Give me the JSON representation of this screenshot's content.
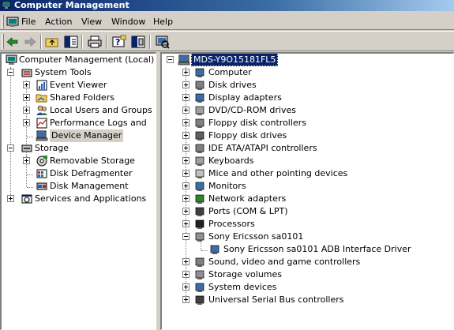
{
  "window": {
    "title": "Computer Management"
  },
  "menu": {
    "file": "File",
    "action": "Action",
    "view": "View",
    "window": "Window",
    "help": "Help"
  },
  "left_tree": {
    "root": "Computer Management (Local)",
    "system_tools": "System Tools",
    "event_viewer": "Event Viewer",
    "shared_folders": "Shared Folders",
    "local_users": "Local Users and Groups",
    "perf_logs": "Performance Logs and Alerts",
    "device_manager": "Device Manager",
    "storage": "Storage",
    "removable_storage": "Removable Storage",
    "disk_defrag": "Disk Defragmenter",
    "disk_management": "Disk Management",
    "services_apps": "Services and Applications"
  },
  "right_tree": {
    "root": "MDS-Y9O15181FL5",
    "items": [
      "Computer",
      "Disk drives",
      "Display adapters",
      "DVD/CD-ROM drives",
      "Floppy disk controllers",
      "Floppy disk drives",
      "IDE ATA/ATAPI controllers",
      "Keyboards",
      "Mice and other pointing devices",
      "Monitors",
      "Network adapters",
      "Ports (COM & LPT)",
      "Processors",
      "Sony Ericsson sa0101",
      "Sony Ericsson sa0101 ADB Interface Driver",
      "Sound, video and game controllers",
      "Storage volumes",
      "System devices",
      "Universal Serial Bus controllers"
    ]
  }
}
